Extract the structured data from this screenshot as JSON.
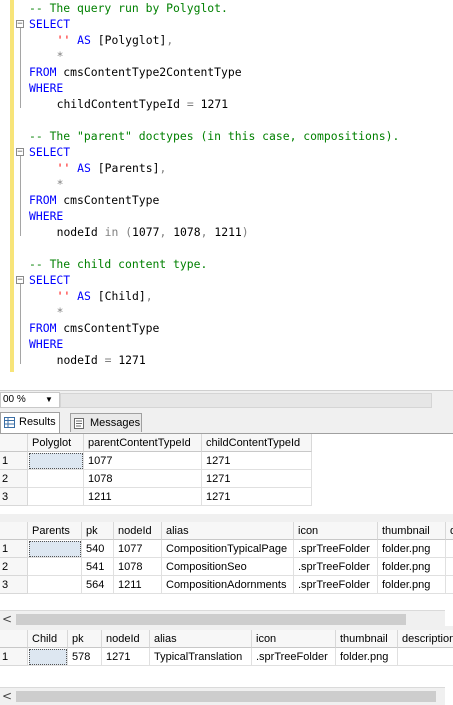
{
  "editor": {
    "lines": [
      {
        "indent": 0,
        "parts": [
          {
            "t": "-- The query run by Polyglot.",
            "c": "cm"
          }
        ]
      },
      {
        "indent": 0,
        "parts": [
          {
            "t": "SELECT",
            "c": "kw"
          }
        ]
      },
      {
        "indent": 4,
        "parts": [
          {
            "t": "''",
            "c": "st"
          },
          {
            "t": " AS ",
            "c": "kw"
          },
          {
            "t": "[Polyglot]",
            "c": ""
          },
          {
            "t": ",",
            "c": "gy"
          }
        ]
      },
      {
        "indent": 4,
        "parts": [
          {
            "t": "*",
            "c": "gy"
          }
        ]
      },
      {
        "indent": 0,
        "parts": [
          {
            "t": "FROM",
            "c": "kw"
          },
          {
            "t": " cmsContentType2ContentType",
            "c": ""
          }
        ]
      },
      {
        "indent": 0,
        "parts": [
          {
            "t": "WHERE",
            "c": "kw"
          }
        ]
      },
      {
        "indent": 4,
        "parts": [
          {
            "t": "childContentTypeId ",
            "c": ""
          },
          {
            "t": "=",
            "c": "gy"
          },
          {
            "t": " 1271",
            "c": ""
          }
        ]
      },
      {
        "indent": 0,
        "parts": []
      },
      {
        "indent": 0,
        "parts": [
          {
            "t": "-- The \"parent\" doctypes (in this case, compositions).",
            "c": "cm"
          }
        ]
      },
      {
        "indent": 0,
        "parts": [
          {
            "t": "SELECT",
            "c": "kw"
          }
        ]
      },
      {
        "indent": 4,
        "parts": [
          {
            "t": "''",
            "c": "st"
          },
          {
            "t": " AS ",
            "c": "kw"
          },
          {
            "t": "[Parents]",
            "c": ""
          },
          {
            "t": ",",
            "c": "gy"
          }
        ]
      },
      {
        "indent": 4,
        "parts": [
          {
            "t": "*",
            "c": "gy"
          }
        ]
      },
      {
        "indent": 0,
        "parts": [
          {
            "t": "FROM",
            "c": "kw"
          },
          {
            "t": " cmsContentType",
            "c": ""
          }
        ]
      },
      {
        "indent": 0,
        "parts": [
          {
            "t": "WHERE",
            "c": "kw"
          }
        ]
      },
      {
        "indent": 4,
        "parts": [
          {
            "t": "nodeId ",
            "c": ""
          },
          {
            "t": "in",
            "c": "gy"
          },
          {
            "t": " ",
            "c": ""
          },
          {
            "t": "(",
            "c": "gy"
          },
          {
            "t": "1077",
            "c": ""
          },
          {
            "t": ", ",
            "c": "gy"
          },
          {
            "t": "1078",
            "c": ""
          },
          {
            "t": ", ",
            "c": "gy"
          },
          {
            "t": "1211",
            "c": ""
          },
          {
            "t": ")",
            "c": "gy"
          }
        ]
      },
      {
        "indent": 0,
        "parts": []
      },
      {
        "indent": 0,
        "parts": [
          {
            "t": "-- The child content type.",
            "c": "cm"
          }
        ]
      },
      {
        "indent": 0,
        "parts": [
          {
            "t": "SELECT",
            "c": "kw"
          }
        ]
      },
      {
        "indent": 4,
        "parts": [
          {
            "t": "''",
            "c": "st"
          },
          {
            "t": " AS ",
            "c": "kw"
          },
          {
            "t": "[Child]",
            "c": ""
          },
          {
            "t": ",",
            "c": "gy"
          }
        ]
      },
      {
        "indent": 4,
        "parts": [
          {
            "t": "*",
            "c": "gy"
          }
        ]
      },
      {
        "indent": 0,
        "parts": [
          {
            "t": "FROM",
            "c": "kw"
          },
          {
            "t": " cmsContentType",
            "c": ""
          }
        ]
      },
      {
        "indent": 0,
        "parts": [
          {
            "t": "WHERE",
            "c": "kw"
          }
        ]
      },
      {
        "indent": 4,
        "parts": [
          {
            "t": "nodeId ",
            "c": ""
          },
          {
            "t": "=",
            "c": "gy"
          },
          {
            "t": " 1271",
            "c": ""
          }
        ]
      }
    ]
  },
  "zoom": {
    "value": "00 %",
    "dropdown_icon": "chevron-down-icon"
  },
  "tabs": [
    {
      "label": "Results",
      "icon": "grid-icon",
      "active": true
    },
    {
      "label": "Messages",
      "icon": "messages-icon",
      "active": false
    }
  ],
  "grids": [
    {
      "columns": [
        "",
        "Polyglot",
        "parentContentTypeId",
        "childContentTypeId"
      ],
      "rows": [
        [
          "1",
          "",
          "1077",
          "1271"
        ],
        [
          "2",
          "",
          "1078",
          "1271"
        ],
        [
          "3",
          "",
          "1211",
          "1271"
        ]
      ],
      "selected": [
        0,
        1
      ],
      "scrollbar": false
    },
    {
      "columns": [
        "",
        "Parents",
        "pk",
        "nodeId",
        "alias",
        "icon",
        "thumbnail",
        "d"
      ],
      "rows": [
        [
          "1",
          "",
          "540",
          "1077",
          "CompositionTypicalPage",
          ".sprTreeFolder",
          "folder.png",
          ""
        ],
        [
          "2",
          "",
          "541",
          "1078",
          "CompositionSeo",
          ".sprTreeFolder",
          "folder.png",
          ""
        ],
        [
          "3",
          "",
          "564",
          "1211",
          "CompositionAdornments",
          ".sprTreeFolder",
          "folder.png",
          ""
        ]
      ],
      "selected": [
        0,
        1
      ],
      "scrollbar": true
    },
    {
      "columns": [
        "",
        "Child",
        "pk",
        "nodeId",
        "alias",
        "icon",
        "thumbnail",
        "description"
      ],
      "rows": [
        [
          "1",
          "",
          "578",
          "1271",
          "TypicalTranslation",
          ".sprTreeFolder",
          "folder.png",
          ""
        ]
      ],
      "selected": [
        0,
        1
      ],
      "scrollbar": true
    }
  ],
  "scroll_arrow": "<"
}
